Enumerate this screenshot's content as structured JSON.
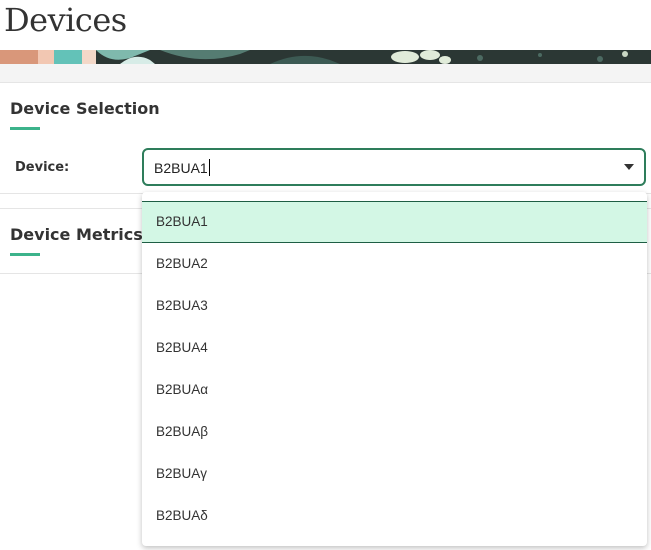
{
  "page": {
    "title": "Devices"
  },
  "selection": {
    "title": "Device Selection",
    "device_label": "Device:",
    "value": "B2BUA1"
  },
  "metrics": {
    "title": "Device Metrics"
  },
  "dropdown": {
    "options": [
      "B2BUA1",
      "B2BUA2",
      "B2BUA3",
      "B2BUA4",
      "B2BUAα",
      "B2BUAβ",
      "B2BUAγ",
      "B2BUAδ"
    ],
    "selected_option": "B2BUA1"
  },
  "colors": {
    "accent": "#3cb38b",
    "select_border": "#2e7d5b",
    "selected_option_bg": "#d3f7e5"
  }
}
